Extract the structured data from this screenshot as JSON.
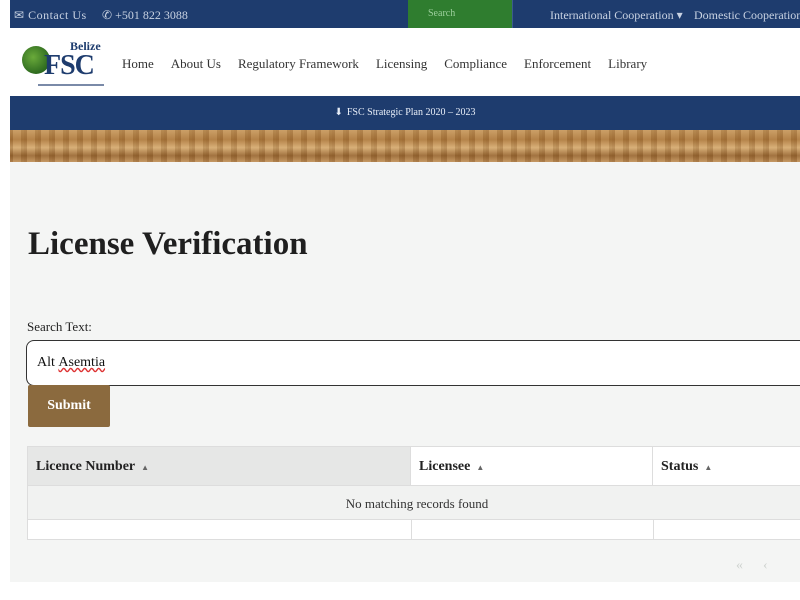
{
  "topbar": {
    "contact": "Contact Us",
    "phone": "+501 822 3088",
    "search_placeholder": "Search",
    "international": "International Cooperation",
    "domestic": "Domestic Cooperation"
  },
  "header": {
    "logo_country": "Belize",
    "logo_text": "FSC",
    "nav": [
      "Home",
      "About Us",
      "Regulatory Framework",
      "Licensing",
      "Compliance",
      "Enforcement",
      "Library"
    ]
  },
  "banner": {
    "plan_link": "FSC Strategic Plan 2020 – 2023",
    "download_icon": "download-icon"
  },
  "main": {
    "title": "License Verification",
    "search_label": "Search Text:",
    "search_value_plain": "Alt ",
    "search_value_misspelled": "Asemtia",
    "submit_label": "Submit"
  },
  "table": {
    "columns": [
      "Licence Number",
      "Licensee",
      "Status"
    ],
    "sort_icon": "▲",
    "empty_message": "No matching records found"
  },
  "pager": {
    "first": "«",
    "prev": "‹"
  },
  "colors": {
    "navy": "#1e3c6e",
    "green": "#2f7d2f",
    "submit": "#8b6a3e"
  }
}
